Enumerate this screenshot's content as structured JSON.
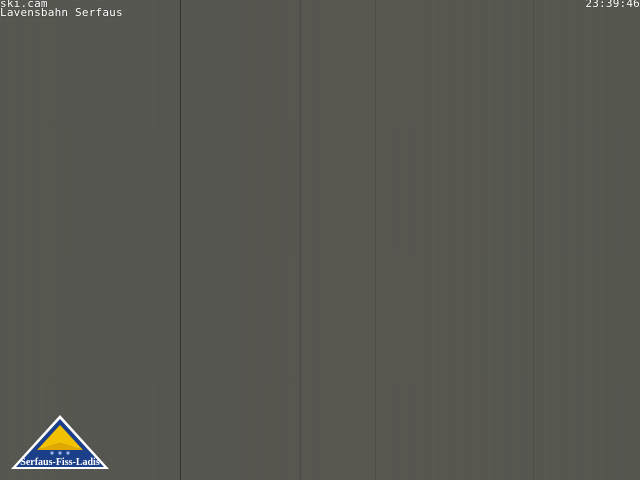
{
  "overlay": {
    "camera_name": "ski.cam",
    "location": "Lavensbahn Serfaus",
    "timestamp": "23:39:46"
  },
  "logo": {
    "text": "Serfaus-Fiss-Ladis",
    "colors": {
      "triangle_outer": "#1c3f8a",
      "triangle_inner": "#f2c200",
      "text": "#ffffff"
    }
  },
  "image": {
    "description_colors": {
      "noise_base": "#55574f"
    }
  }
}
